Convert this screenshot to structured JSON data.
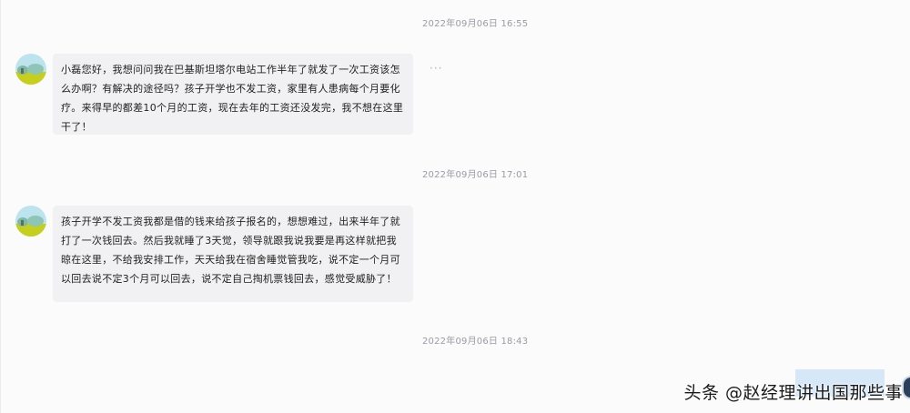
{
  "messages": [
    {
      "timestamp": "2022年09月06日 16:55",
      "text": "小磊您好，我想问问我在巴基斯坦塔尔电站工作半年了就发了一次工资该怎么办啊？有解决的途径吗？孩子开学也不发工资，家里有人患病每个月要化疗。来得早的都差10个月的工资，现在去年的工资还没发完，我不想在这里干了！"
    },
    {
      "timestamp": "2022年09月06日 17:01",
      "text": "孩子开学不发工资我都是借的钱来给孩子报名的，想想难过，出来半年了就打了一次钱回去。然后我就睡了3天觉，领导就跟我说我要是再这样就把我晾在这里，不给我安排工作，天天给我在宿舍睡觉管我吃，说不定一个月可以回去说不定3个月可以回去，说不定自己掏机票钱回去，感觉受威胁了！"
    },
    {
      "timestamp": "2022年09月06日 18:43"
    }
  ],
  "more_icon": "···",
  "watermark": "头条 @赵经理讲出国那些事",
  "colors": {
    "bubble": "#f1f1f3",
    "timestamp": "#9a9ca3",
    "text": "#1f1f1f",
    "avatar_sky": "#bde3ee",
    "avatar_ground": "#c5cf1c"
  }
}
